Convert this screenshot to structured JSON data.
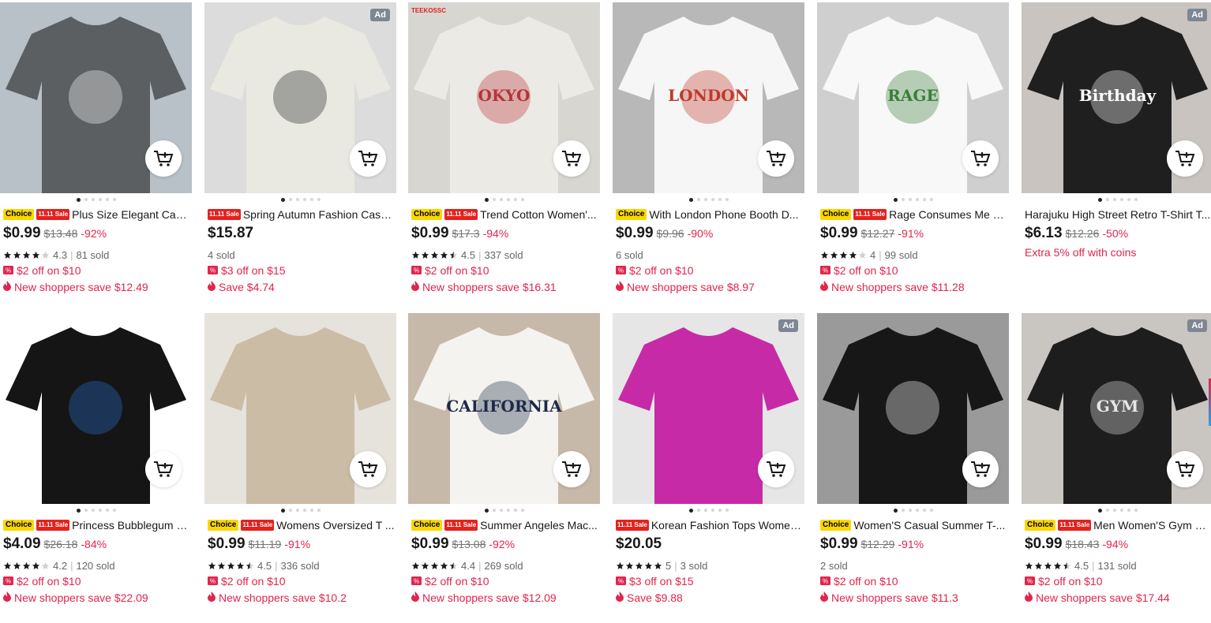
{
  "products": [
    {
      "title": "Plus Size Elegant Casu...",
      "choice": "Choice",
      "sale": "11.11 Sale",
      "price": "$0.99",
      "orig": "$13.48",
      "disc": "-92%",
      "rating": "4.3",
      "stars": 4,
      "sold": "81 sold",
      "coupon": "$2 off on $10",
      "save": "New shoppers save $12.49",
      "ad": "",
      "brand": ""
    },
    {
      "title": "Spring Autumn Fashion Casu...",
      "choice": "",
      "sale": "11.11 Sale",
      "price": "$15.87",
      "orig": "",
      "disc": "",
      "rating": "",
      "stars": 0,
      "sold": "4 sold",
      "coupon": "$3 off on $15",
      "save": "Save $4.74",
      "ad": "Ad",
      "brand": ""
    },
    {
      "title": "Trend Cotton Women'...",
      "choice": "Choice",
      "sale": "11.11 Sale",
      "price": "$0.99",
      "orig": "$17.3",
      "disc": "-94%",
      "rating": "4.5",
      "stars": 4.5,
      "sold": "337 sold",
      "coupon": "$2 off on $10",
      "save": "New shoppers save $16.31",
      "ad": "",
      "brand": "TEEKOSSC"
    },
    {
      "title": "With London Phone Booth D...",
      "choice": "Choice",
      "sale": "",
      "price": "$0.99",
      "orig": "$9.96",
      "disc": "-90%",
      "rating": "",
      "stars": 0,
      "sold": "6 sold",
      "coupon": "$2 off on $10",
      "save": "New shoppers save $8.97",
      "ad": "",
      "brand": ""
    },
    {
      "title": "Rage Consumes Me Fr...",
      "choice": "Choice",
      "sale": "11.11 Sale",
      "price": "$0.99",
      "orig": "$12.27",
      "disc": "-91%",
      "rating": "4",
      "stars": 4,
      "sold": "99 sold",
      "coupon": "$2 off on $10",
      "save": "New shoppers save $11.28",
      "ad": "",
      "brand": ""
    },
    {
      "title": "Harajuku High Street Retro T-Shirt T...",
      "choice": "",
      "sale": "",
      "price": "$6.13",
      "orig": "$12.26",
      "disc": "-50%",
      "rating": "",
      "stars": 0,
      "sold": "",
      "coupon": "",
      "save": "",
      "coins": "Extra 5% off with coins",
      "ad": "Ad",
      "brand": ""
    },
    {
      "title": "Princess Bubblegum R...",
      "choice": "Choice",
      "sale": "11.11 Sale",
      "price": "$4.09",
      "orig": "$26.18",
      "disc": "-84%",
      "rating": "4.2",
      "stars": 4,
      "sold": "120 sold",
      "coupon": "$2 off on $10",
      "save": "New shoppers save $22.09",
      "ad": "",
      "brand": ""
    },
    {
      "title": "Womens Oversized T ...",
      "choice": "Choice",
      "sale": "11.11 Sale",
      "price": "$0.99",
      "orig": "$11.19",
      "disc": "-91%",
      "rating": "4.5",
      "stars": 4.5,
      "sold": "336 sold",
      "coupon": "$2 off on $10",
      "save": "New shoppers save $10.2",
      "ad": "",
      "brand": ""
    },
    {
      "title": "Summer Angeles Mac...",
      "choice": "Choice",
      "sale": "11.11 Sale",
      "price": "$0.99",
      "orig": "$13.08",
      "disc": "-92%",
      "rating": "4.4",
      "stars": 4.5,
      "sold": "269 sold",
      "coupon": "$2 off on $10",
      "save": "New shoppers save $12.09",
      "ad": "",
      "brand": ""
    },
    {
      "title": "Korean Fashion Tops Women...",
      "choice": "",
      "sale": "11.11 Sale",
      "price": "$20.05",
      "orig": "",
      "disc": "",
      "rating": "5",
      "stars": 5,
      "sold": "3 sold",
      "coupon": "$3 off on $15",
      "save": "Save $9.88",
      "ad": "Ad",
      "brand": ""
    },
    {
      "title": "Women'S Casual Summer T-...",
      "choice": "Choice",
      "sale": "",
      "price": "$0.99",
      "orig": "$12.29",
      "disc": "-91%",
      "rating": "",
      "stars": 0,
      "sold": "2 sold",
      "coupon": "$2 off on $10",
      "save": "New shoppers save $11.3",
      "ad": "",
      "brand": ""
    },
    {
      "title": "Men Women'S Gym wi...",
      "choice": "Choice",
      "sale": "11.11 Sale",
      "price": "$0.99",
      "orig": "$18.43",
      "disc": "-94%",
      "rating": "4.5",
      "stars": 4.5,
      "sold": "131 sold",
      "coupon": "$2 off on $10",
      "save": "New shoppers save $17.44",
      "ad": "Ad",
      "brand": ""
    }
  ],
  "shirt_art": [
    {
      "text": "",
      "bg": "#b8c0c8",
      "shirt": "#5c5f62",
      "ink": "#ffffff"
    },
    {
      "text": "",
      "bg": "#dcdcdc",
      "shirt": "#e9e9e2",
      "ink": "#222222"
    },
    {
      "text": "OKYO",
      "bg": "#d8d6d0",
      "shirt": "#eceae4",
      "ink": "#b6343a"
    },
    {
      "text": "LONDON",
      "bg": "#b8b8b8",
      "shirt": "#f6f6f6",
      "ink": "#c0392b"
    },
    {
      "text": "RAGE",
      "bg": "#cfcfcf",
      "shirt": "#f8f8f8",
      "ink": "#3b7d3a"
    },
    {
      "text": "Birthday",
      "bg": "#c9c4bf",
      "shirt": "#1f1f1f",
      "ink": "#ffffff"
    },
    {
      "text": "",
      "bg": "#ffffff",
      "shirt": "#151515",
      "ink": "#2b6fd1"
    },
    {
      "text": "",
      "bg": "#e6e2dc",
      "shirt": "#cbbca6",
      "ink": "#cbbca6"
    },
    {
      "text": "CALIFORNIA",
      "bg": "#c7b9a9",
      "shirt": "#f5f3ef",
      "ink": "#1c2a48"
    },
    {
      "text": "",
      "bg": "#e6e6e6",
      "shirt": "#c72aa6",
      "ink": "#c72aa6"
    },
    {
      "text": "",
      "bg": "#9a9a9a",
      "shirt": "#171717",
      "ink": "#ffffff"
    },
    {
      "text": "GYM",
      "bg": "#c9c6c2",
      "shirt": "#1d1d1d",
      "ink": "#e6e6e6"
    }
  ],
  "colors": {
    "accent": "#e1254c",
    "choice": "#fad700",
    "sale": "#e4221e"
  },
  "icons": {
    "cart": "add-to-cart-icon",
    "coupon": "coupon-icon",
    "flame": "flame-icon",
    "star": "star-icon"
  }
}
